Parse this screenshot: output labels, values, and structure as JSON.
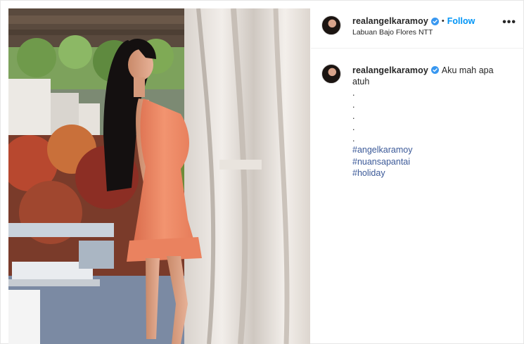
{
  "post": {
    "username": "realangelkaramoy",
    "follow_label": "Follow",
    "separator": "•",
    "location": "Labuan Bajo Flores NTT",
    "more_label": "•••",
    "caption_first": "Aku mah apa",
    "caption_second": "atuh",
    "dots": [
      ".",
      ".",
      ".",
      ".",
      "."
    ],
    "hashtags": [
      "#angelkaramoy",
      "#nuansapantai",
      "#holiday"
    ],
    "icons": {
      "verified": "verified-badge-icon",
      "more": "more-options-icon"
    },
    "colors": {
      "follow": "#0095f6",
      "hashtag": "#3b5998",
      "verified": "#3897f0",
      "dress": "#f08a64"
    }
  }
}
